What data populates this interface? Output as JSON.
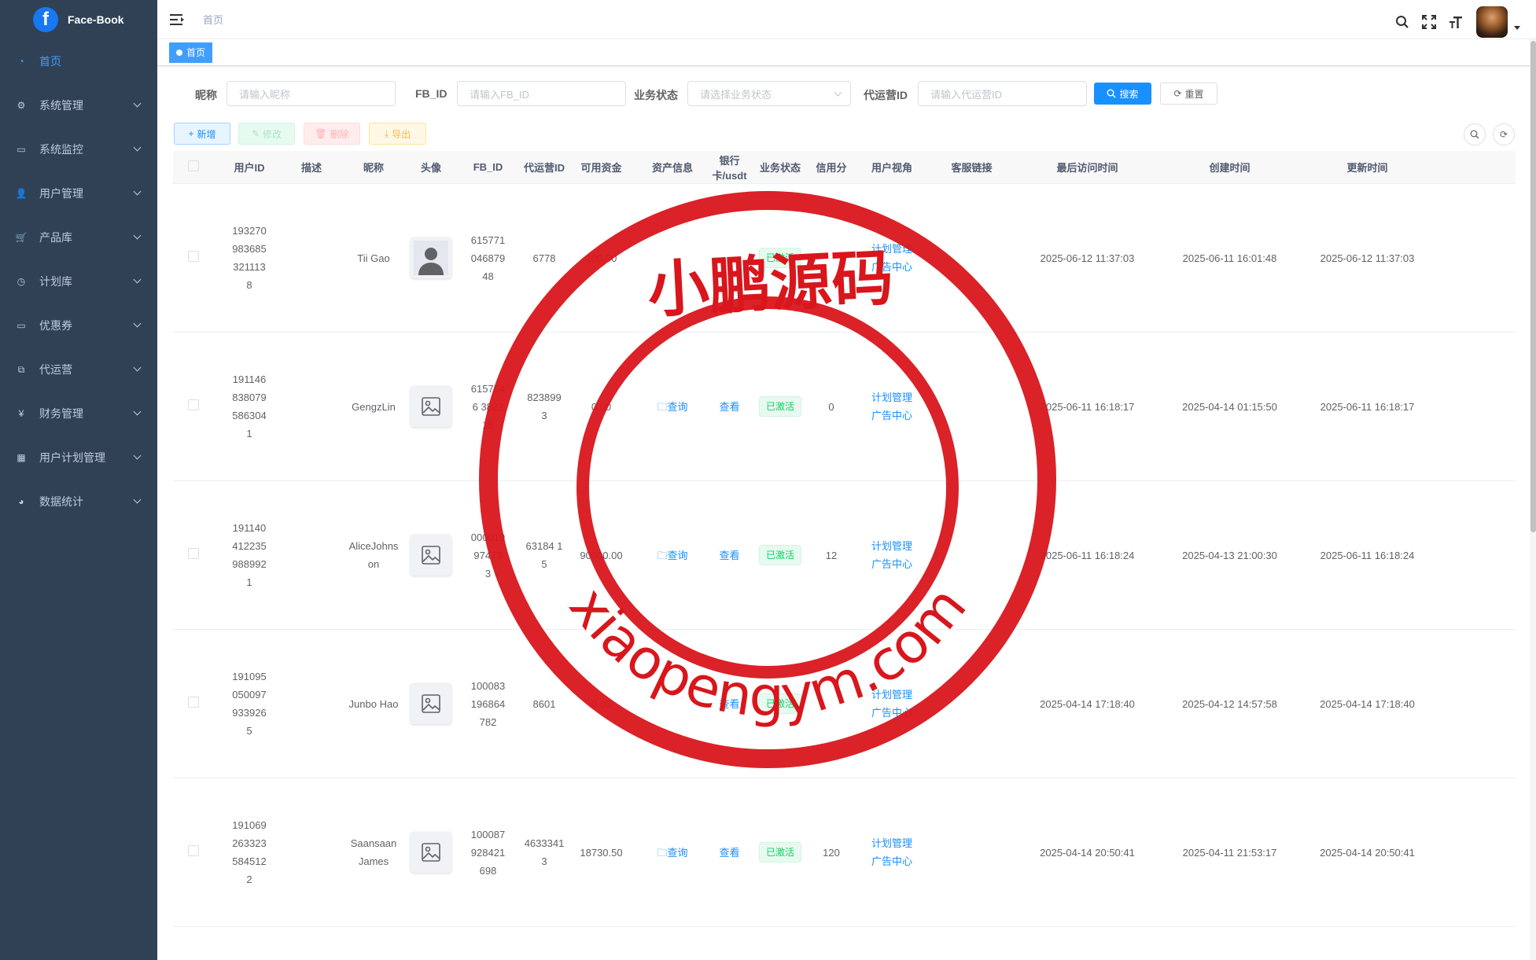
{
  "app": {
    "title": "Face-Book",
    "logo_letter": "f"
  },
  "sidebar": {
    "items": [
      {
        "label": "首页",
        "icon": "dashboard-icon",
        "active": true,
        "has_children": false
      },
      {
        "label": "系统管理",
        "icon": "gear-icon",
        "has_children": true
      },
      {
        "label": "系统监控",
        "icon": "monitor-icon",
        "has_children": true
      },
      {
        "label": "用户管理",
        "icon": "user-icon",
        "has_children": true
      },
      {
        "label": "产品库",
        "icon": "cart-icon",
        "has_children": true
      },
      {
        "label": "计划库",
        "icon": "clock-icon",
        "has_children": true
      },
      {
        "label": "优惠券",
        "icon": "coupon-icon",
        "has_children": true
      },
      {
        "label": "代运营",
        "icon": "tree-icon",
        "has_children": true
      },
      {
        "label": "财务管理",
        "icon": "yen-icon",
        "has_children": true
      },
      {
        "label": "用户计划管理",
        "icon": "table-icon",
        "has_children": true
      },
      {
        "label": "数据统计",
        "icon": "chart-icon",
        "has_children": true
      }
    ]
  },
  "navbar": {
    "breadcrumb": "首页"
  },
  "tags": {
    "active": "首页"
  },
  "search": {
    "nickname_label": "昵称",
    "nickname_placeholder": "请输入昵称",
    "fbid_label": "FB_ID",
    "fbid_placeholder": "请输入FB_ID",
    "status_label": "业务状态",
    "status_placeholder": "请选择业务状态",
    "agent_label": "代运营ID",
    "agent_placeholder": "请输入代运营ID",
    "search_btn": "搜索",
    "reset_btn": "重置"
  },
  "toolbar": {
    "add": "新增",
    "edit": "修改",
    "delete": "删除",
    "export": "导出"
  },
  "table": {
    "headers": [
      "用户ID",
      "描述",
      "昵称",
      "头像",
      "FB_ID",
      "代运营ID",
      "可用资金",
      "资产信息",
      "银行卡/usdt",
      "业务状态",
      "信用分",
      "用户视角",
      "客服链接",
      "最后访问时间",
      "创建时间",
      "更新时间"
    ],
    "rows": [
      {
        "user_id": "1932709836853211138",
        "desc": "",
        "nickname": "Tii Gao",
        "avatar": "person",
        "fb_id": "61577104687948",
        "agent_id": "6778",
        "funds": "100.00",
        "asset": "",
        "bank": "",
        "status": "已激活",
        "credit": "",
        "view1": "计划管理",
        "view2": "广告中心",
        "cs_link": "",
        "last_visit": "2025-06-12 11:37:03",
        "created": "2025-06-11 16:01:48",
        "updated": "2025-06-12 11:37:03"
      },
      {
        "user_id": "1911468380795863041",
        "desc": "",
        "nickname": "GengzLin",
        "avatar": "image",
        "fb_id": "6157546 382315",
        "agent_id": "823899 3",
        "funds": "0.00",
        "asset": "查询",
        "bank": "查看",
        "status": "已激活",
        "credit": "0",
        "view1": "计划管理",
        "view2": "广告中心",
        "cs_link": "",
        "last_visit": "2025-06-11 16:18:17",
        "created": "2025-04-14 01:15:50",
        "updated": "2025-06-11 16:18:17"
      },
      {
        "user_id": "1911404122359889921",
        "desc": "",
        "nickname": "AliceJohnson",
        "avatar": "image",
        "fb_id": "000019 97473 3",
        "agent_id": "63184 15",
        "funds": "90000.00",
        "asset": "查询",
        "bank": "查看",
        "status": "已激活",
        "credit": "12",
        "view1": "计划管理",
        "view2": "广告中心",
        "cs_link": "",
        "last_visit": "2025-06-11 16:18:24",
        "created": "2025-04-13 21:00:30",
        "updated": "2025-06-11 16:18:24"
      },
      {
        "user_id": "1910950500979339265",
        "desc": "",
        "nickname": "Junbo Hao",
        "avatar": "image",
        "fb_id": "100083196864782",
        "agent_id": "8601",
        "funds": "0.00",
        "asset": "",
        "bank": "查看",
        "status": "已激活",
        "credit": "",
        "view1": "计划管理",
        "view2": "广告中心",
        "cs_link": "",
        "last_visit": "2025-04-14 17:18:40",
        "created": "2025-04-12 14:57:58",
        "updated": "2025-04-14 17:18:40"
      },
      {
        "user_id": "1910692633235845122",
        "desc": "",
        "nickname": "Saansaan James",
        "avatar": "image",
        "fb_id": "100087928421698",
        "agent_id": "46333413",
        "funds": "18730.50",
        "asset": "查询",
        "bank": "查看",
        "status": "已激活",
        "credit": "120",
        "view1": "计划管理",
        "view2": "广告中心",
        "cs_link": "",
        "last_visit": "2025-04-14 20:50:41",
        "created": "2025-04-11 21:53:17",
        "updated": "2025-04-14 20:50:41"
      }
    ]
  },
  "watermark": {
    "top_text": "小鹏源码",
    "bottom_text": "xiaopengym.com",
    "color": "#d8161c"
  },
  "colors": {
    "primary": "#1890ff",
    "sidebar_bg": "#304156",
    "success": "#13ce66"
  }
}
